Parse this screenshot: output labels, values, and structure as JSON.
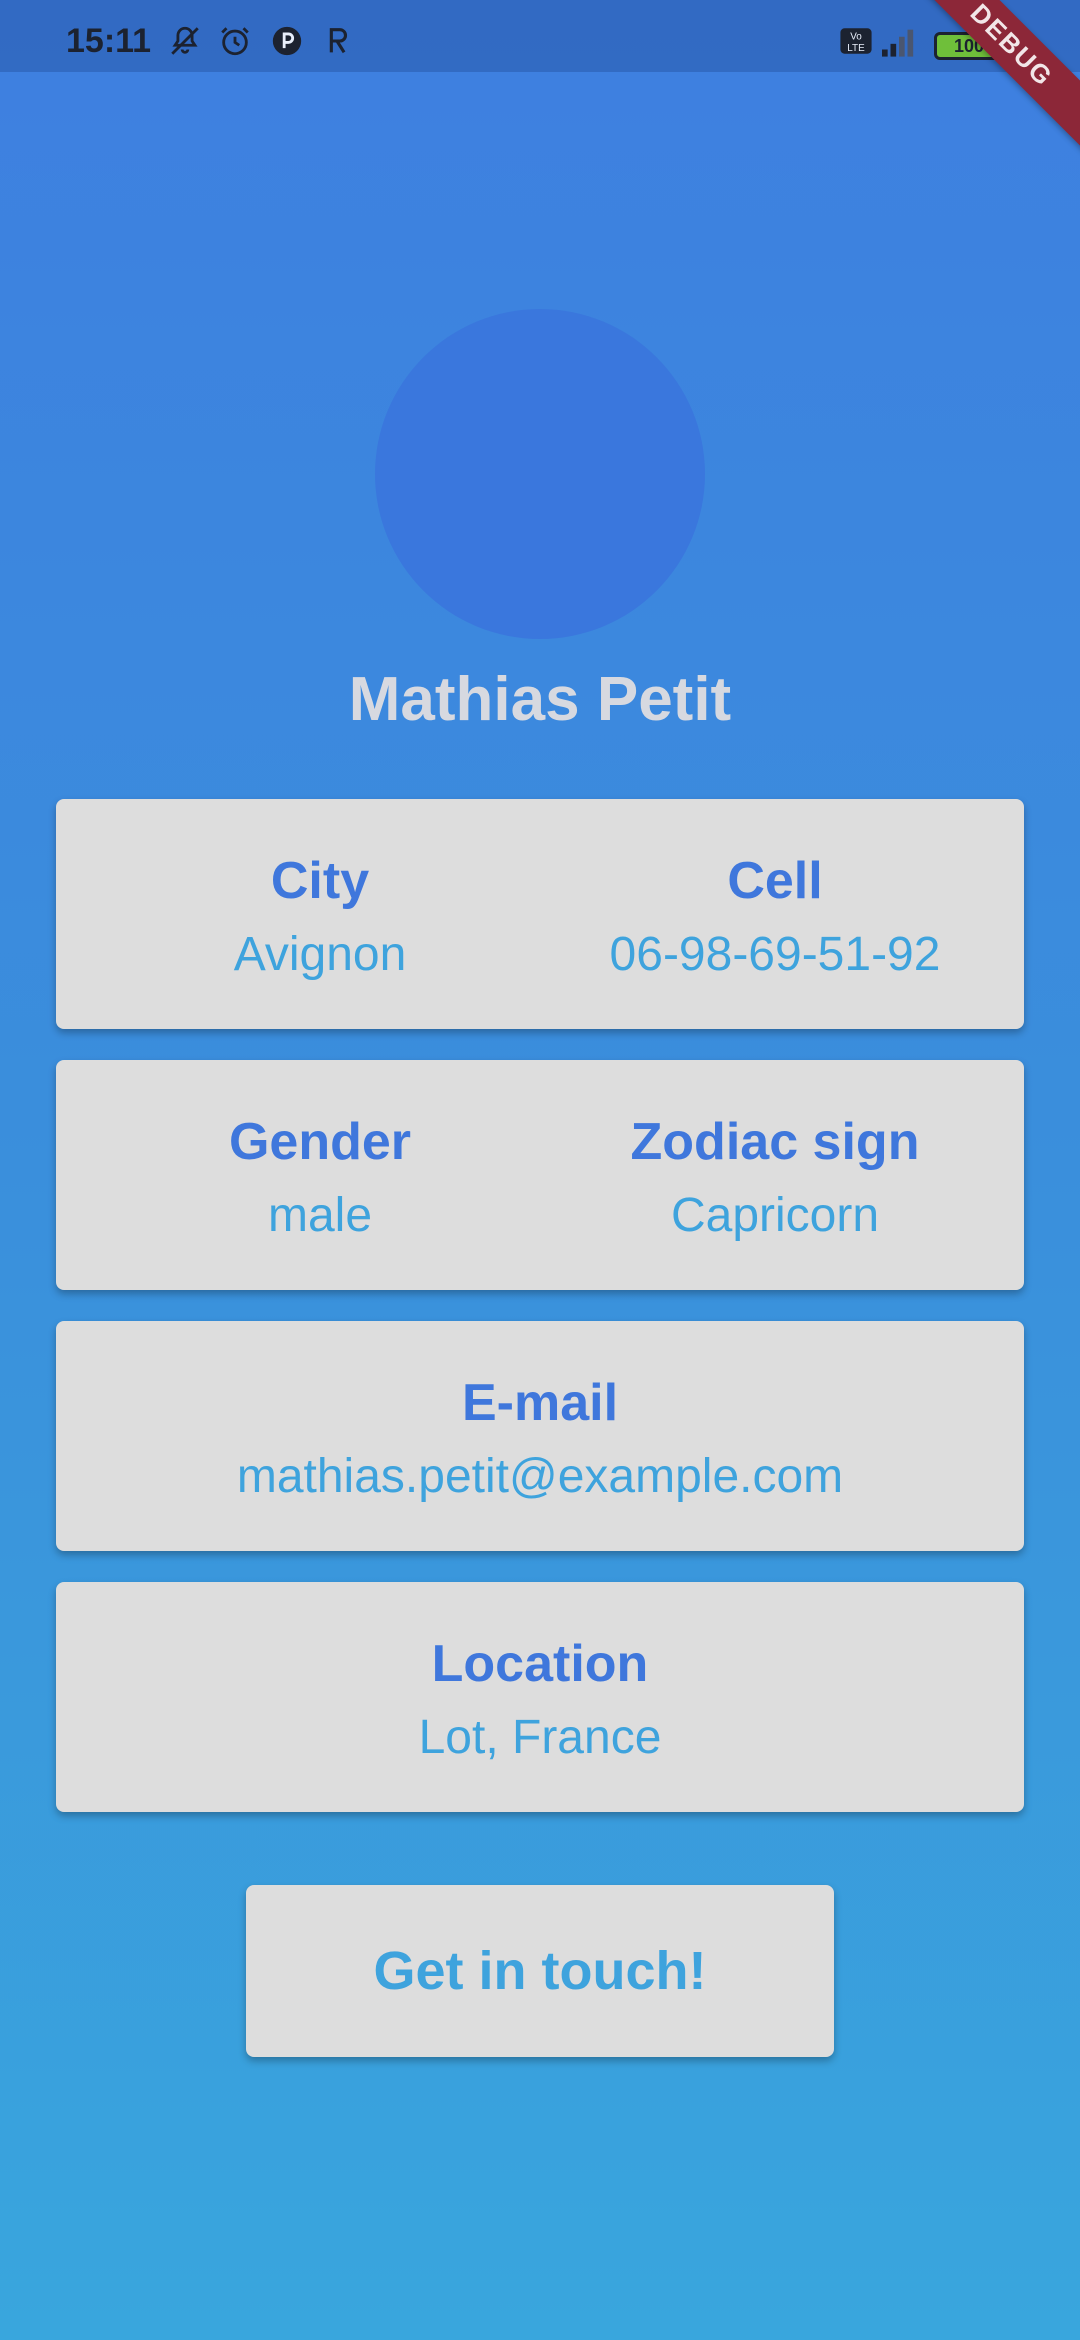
{
  "status_bar": {
    "time": "15:11",
    "battery": "100",
    "icons": [
      "bell-off-icon",
      "alarm-icon",
      "app-p-icon",
      "app-r-icon",
      "volte-icon",
      "signal-icon",
      "battery-icon",
      "charging-icon"
    ]
  },
  "debug_banner": "DEBUG",
  "profile": {
    "name": "Mathias Petit"
  },
  "cards": {
    "city": {
      "label": "City",
      "value": "Avignon"
    },
    "cell": {
      "label": "Cell",
      "value": "06-98-69-51-92"
    },
    "gender": {
      "label": "Gender",
      "value": "male"
    },
    "zodiac": {
      "label": "Zodiac sign",
      "value": "Capricorn"
    },
    "email": {
      "label": "E-mail",
      "value": "mathias.petit@example.com"
    },
    "location": {
      "label": "Location",
      "value": "Lot, France"
    }
  },
  "contact_button": "Get in touch!",
  "colors": {
    "label": "#3f77dc",
    "value": "#3ea3dd",
    "card": "#dddddd",
    "avatar": "#3a77dd",
    "gradient_top": "#3e7fe0",
    "gradient_bottom": "#39a6dd"
  }
}
